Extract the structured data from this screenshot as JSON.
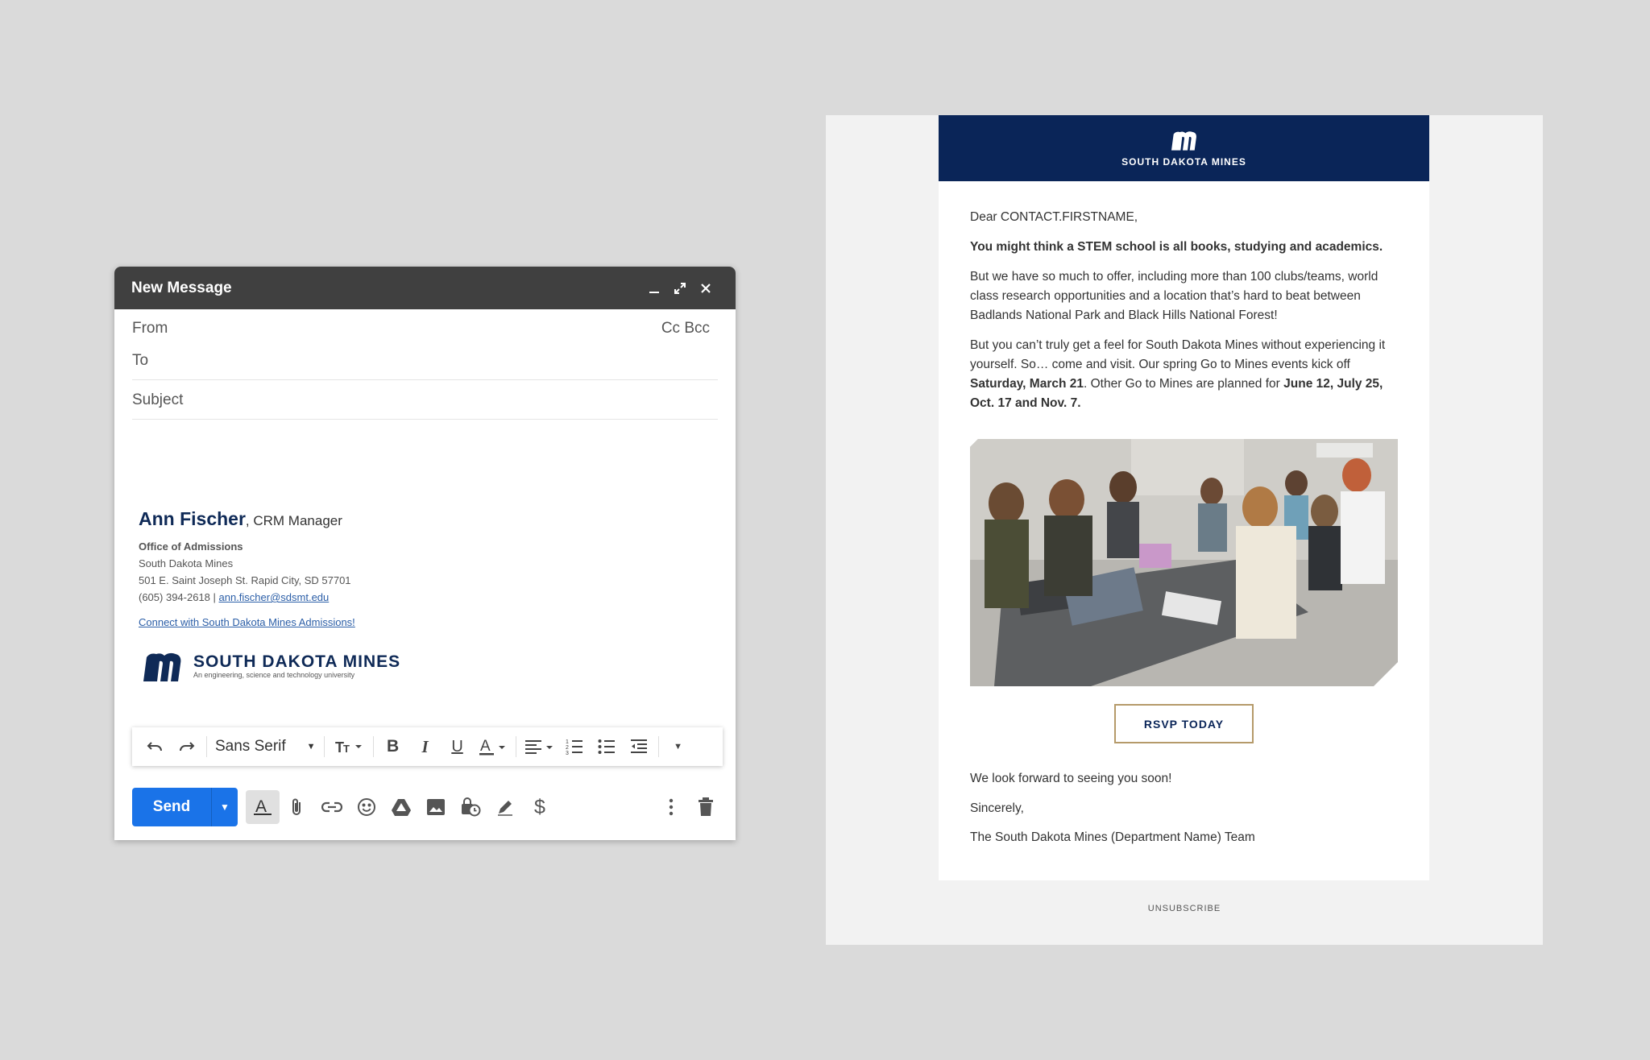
{
  "compose": {
    "title": "New Message",
    "fields": {
      "from": "From",
      "cc_bcc": "Cc Bcc",
      "to": "To",
      "subject": "Subject"
    },
    "signature": {
      "name": "Ann Fischer",
      "role": ", CRM Manager",
      "department": "Office of Admissions",
      "org": "South Dakota Mines",
      "address": "501 E. Saint Joseph St. Rapid City, SD 57701",
      "phone": "(605) 394-2618 | ",
      "email": "ann.fischer@sdsmt.edu",
      "connect_link": "Connect with South Dakota Mines Admissions!",
      "logo_wordmark": "SOUTH DAKOTA MINES",
      "logo_tagline": "An engineering, science and technology university"
    },
    "toolbar": {
      "font": "Sans Serif"
    },
    "send_label": "Send",
    "icons": [
      "minimize-icon",
      "expand-icon",
      "close-icon",
      "undo-icon",
      "redo-icon",
      "text-size-icon",
      "bold-icon",
      "italic-icon",
      "underline-icon",
      "text-color-icon",
      "align-icon",
      "numbered-list-icon",
      "bulleted-list-icon",
      "indent-icon",
      "formatting-icon",
      "attach-icon",
      "link-icon",
      "emoji-icon",
      "drive-icon",
      "photo-icon",
      "confidential-icon",
      "signature-icon",
      "dollar-icon",
      "more-icon",
      "trash-icon"
    ]
  },
  "email": {
    "brand": "SOUTH DAKOTA MINES",
    "brand_color": "#0a2558",
    "greeting": "Dear CONTACT.FIRSTNAME,",
    "headline": "You might think a STEM school is all books, studying and academics.",
    "para1": "But we have so much to offer, including more than 100 clubs/teams, world class research opportunities and a location that’s hard to beat between Badlands National Park and Black Hills National Forest!",
    "para2_a": "But you can’t truly get a feel for South Dakota Mines without experiencing it yourself. So… come and visit. Our spring Go to Mines events kick off ",
    "para2_b": "Saturday, March 21",
    "para2_c": ". Other Go to Mines are planned for ",
    "para2_d": "June 12, July 25, Oct. 17 and Nov. 7.",
    "rsvp": "RSVP TODAY",
    "closing1": "We look forward to seeing you soon!",
    "closing2": "Sincerely,",
    "closing3": "The South Dakota Mines (Department Name) Team",
    "unsubscribe": "UNSUBSCRIBE"
  }
}
